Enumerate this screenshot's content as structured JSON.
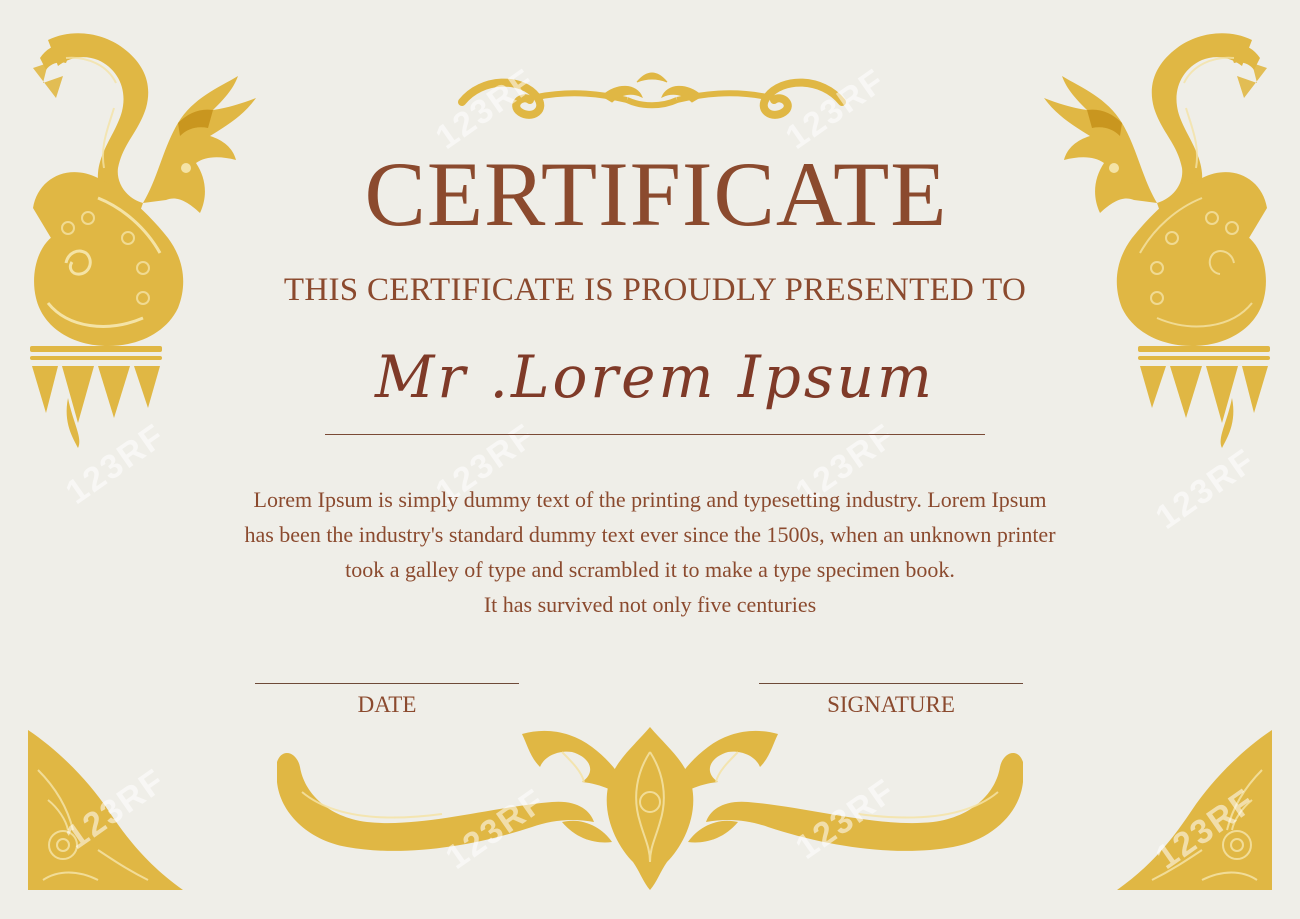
{
  "certificate": {
    "title": "CERTIFICATE",
    "subtitle": "THIS CERTIFICATE IS PROUDLY PRESENTED TO",
    "recipient_name": "Mr .Lorem  Ipsum",
    "body_lines": [
      "Lorem Ipsum is simply dummy text of the printing and typesetting industry. Lorem Ipsum",
      "has been the industry's standard dummy text ever since the 1500s, when an unknown printer",
      "took a galley of type and scrambled it to make a type specimen book.",
      "It has survived not only five centuries"
    ],
    "date_label": "DATE",
    "signature_label": "SIGNATURE"
  },
  "watermark_text": "123RF",
  "colors": {
    "background": "#efeee8",
    "text_brown": "#8b4a2e",
    "gold": "#e0b744",
    "gold_dark": "#c9961f"
  },
  "icons": [
    "naga-dragon-ornament",
    "thai-flourish-ornament",
    "thai-corner-ornament",
    "lotus-ornament"
  ]
}
